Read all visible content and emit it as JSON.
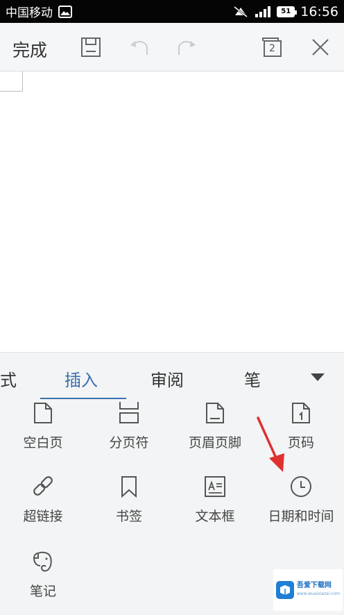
{
  "status_bar": {
    "carrier": "中国移动",
    "battery": "51",
    "time": "16:56"
  },
  "toolbar": {
    "done_label": "完成",
    "window_count": "2"
  },
  "tabs": [
    {
      "label": "式",
      "active": false
    },
    {
      "label": "插入",
      "active": true
    },
    {
      "label": "审阅",
      "active": false
    },
    {
      "label": "笔",
      "active": false
    }
  ],
  "insert_items": [
    {
      "label": "空白页",
      "icon": "blank-page-icon"
    },
    {
      "label": "分页符",
      "icon": "page-break-icon"
    },
    {
      "label": "页眉页脚",
      "icon": "header-footer-icon"
    },
    {
      "label": "页码",
      "icon": "page-number-icon"
    },
    {
      "label": "超链接",
      "icon": "link-icon"
    },
    {
      "label": "书签",
      "icon": "bookmark-icon"
    },
    {
      "label": "文本框",
      "icon": "text-box-icon"
    },
    {
      "label": "日期和时间",
      "icon": "clock-icon"
    },
    {
      "label": "笔记",
      "icon": "evernote-icon"
    }
  ],
  "watermark": {
    "name": "吾爱下载网",
    "url": "www.wuaixiazai.com"
  },
  "colors": {
    "accent": "#3b6fb0",
    "arrow": "#e03030",
    "status_bar": "#050505"
  }
}
